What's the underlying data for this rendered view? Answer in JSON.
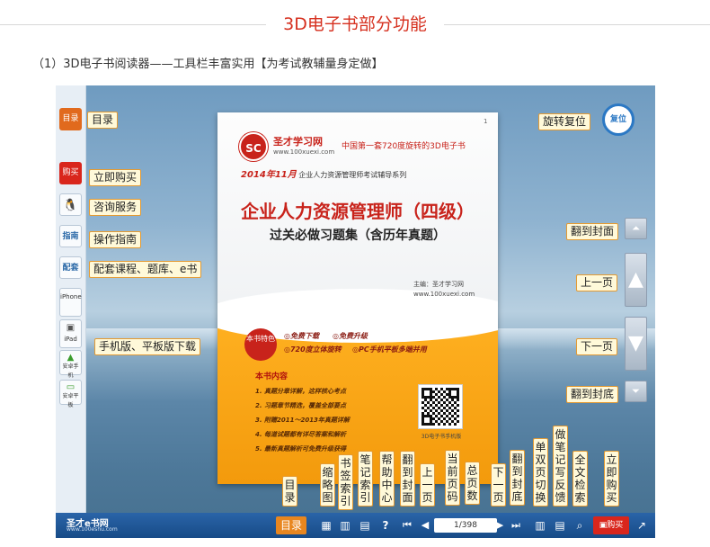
{
  "header": {
    "title": "3D电子书部分功能",
    "subtitle": "（1）3D电子书阅读器——工具栏丰富实用【为考试教辅量身定做】"
  },
  "sidebar": {
    "menu_btn": "目录",
    "buy_btn": "购买",
    "guide_btn": "指南",
    "package_btn": "配套",
    "iphone_btn": "iPhone",
    "ipad_btn": "iPad",
    "android_phone_btn": "安卓手机",
    "android_pad_btn": "安卓平板"
  },
  "left_labels": {
    "menu": "目录",
    "buy": "立即购买",
    "consult": "咨询服务",
    "guide": "操作指南",
    "package": "配套课程、题库、e书",
    "download": "手机版、平板版下载"
  },
  "right_labels": {
    "rotate": "旋转复位",
    "first": "翻到封面",
    "prev": "上一页",
    "next": "下一页",
    "last": "翻到封底"
  },
  "rotate_btn": "复位",
  "bottom_labels": {
    "menu": "目录",
    "thumbs": "缩略图",
    "bookmark": "书签索引",
    "notes": "笔记索引",
    "help": "帮助中心",
    "cover": "翻到封面",
    "prev": "上一页",
    "current": "当前页码",
    "total": "总页数",
    "next": "下一页",
    "back": "翻到封底",
    "switch": "单双页切换",
    "feedback": "做笔记写反馈",
    "search": "全文检索",
    "buy": "立即购买"
  },
  "book": {
    "page_number": "1",
    "logo_text": "SC",
    "brand": "圣才学习网",
    "brand_url": "www.100xuexi.com",
    "tagline": "中国第一套720度旋转的3D电子书",
    "series_date": "2014年11月",
    "series": "企业人力资源管理师考试辅导系列",
    "title": "企业人力资源管理师（四级）",
    "subtitle": "过关必做习题集（含历年真题）",
    "editor": "主编：圣才学习网",
    "editor_url": "www.100xuexi.com",
    "badge": "本书特色",
    "features": [
      "免费下载",
      "免费升级",
      "720度立体旋转",
      "PC手机平板多端并用"
    ],
    "content_title": "本书内容",
    "content_items": [
      "1. 真题分章详解，这样核心考点",
      "2. 习题章节精选，覆盖全部要点",
      "3. 附赠2011～2013年真题详解",
      "4. 每道试题都有详尽答案和解析",
      "5. 最新真题解析可免费升级获得"
    ],
    "qr_caption": "3D电子书手机版"
  },
  "toolbar": {
    "logo": "圣才e书网",
    "logo_url": "www.100eshu.com",
    "menu": "目录",
    "page": "1/398",
    "buy": "购买"
  }
}
